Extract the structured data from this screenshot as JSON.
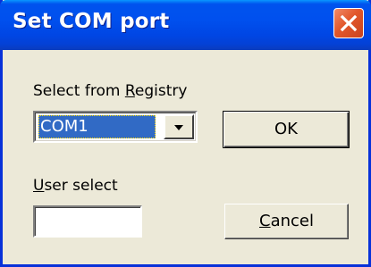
{
  "window": {
    "title": "Set COM port",
    "close_icon": "close-icon"
  },
  "registry": {
    "label_prefix": "Select from ",
    "label_mnemonic": "R",
    "label_suffix": "egistry",
    "selected_value": "COM1",
    "dropdown_icon": "chevron-down-icon"
  },
  "user_select": {
    "label_mnemonic": "U",
    "label_suffix": "ser select",
    "value": ""
  },
  "buttons": {
    "ok_label": "OK",
    "cancel_mnemonic": "C",
    "cancel_suffix": "ancel"
  },
  "colors": {
    "titlebar": "#0050ee",
    "dialog_face": "#ece9d8",
    "selection": "#316ac5",
    "close_button": "#e2572b"
  }
}
